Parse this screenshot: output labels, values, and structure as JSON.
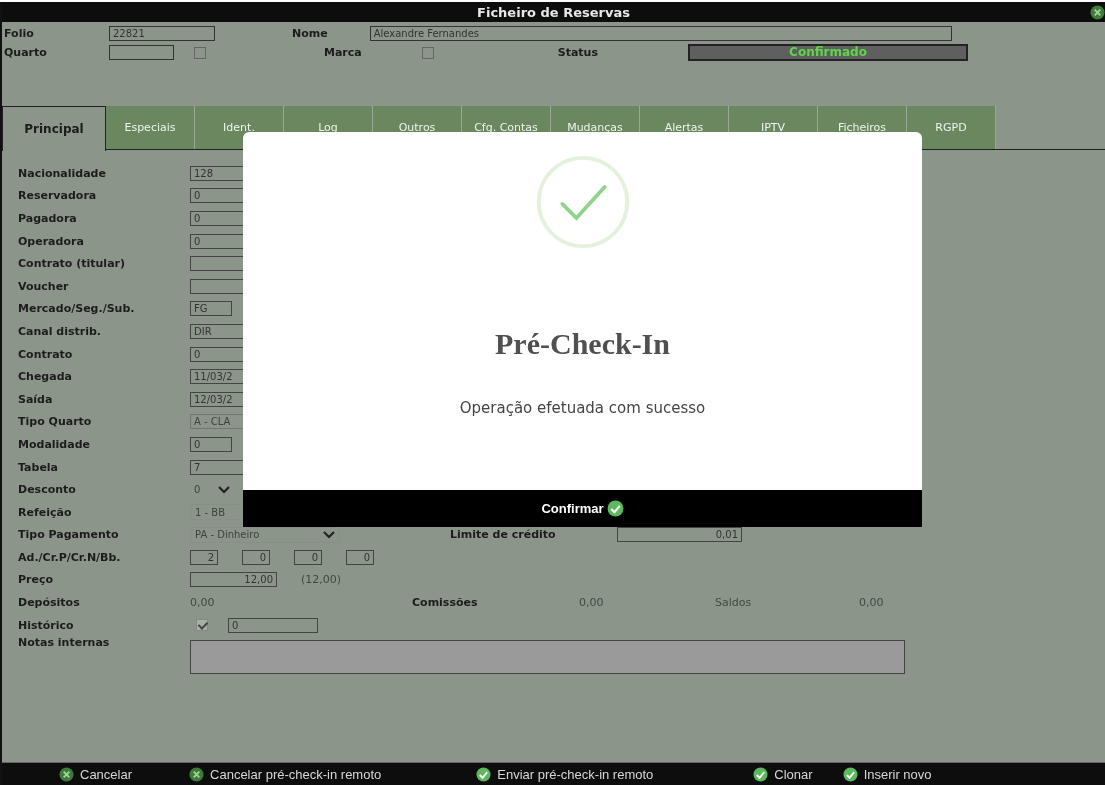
{
  "window": {
    "title": "Ficheiro de Reservas"
  },
  "header": {
    "folio_label": "Folio",
    "folio": "22821",
    "nome_label": "Nome",
    "nome": "Alexandre Fernandes",
    "quarto_label": "Quarto",
    "quarto_checked": false,
    "marca_label": "Marca",
    "marca_checked": false,
    "status_label": "Status",
    "status": "Confirmado"
  },
  "tabs": [
    {
      "label": "Principal",
      "selected": true
    },
    {
      "label": "Especiais",
      "selected": false
    },
    {
      "label": "Ident.",
      "selected": false
    },
    {
      "label": "Log",
      "selected": false
    },
    {
      "label": "Outros",
      "selected": false
    },
    {
      "label": "Cfg. Contas",
      "selected": false
    },
    {
      "label": "Mudanças",
      "selected": false
    },
    {
      "label": "Alertas",
      "selected": false
    },
    {
      "label": "IPTV",
      "selected": false
    },
    {
      "label": "Ficheiros",
      "selected": false
    },
    {
      "label": "RGPD",
      "selected": false
    }
  ],
  "form": {
    "rows": [
      {
        "label": "Nacionalidade",
        "controls": [
          {
            "kind": "input",
            "value": "128"
          }
        ]
      },
      {
        "label": "Reservadora",
        "controls": [
          {
            "kind": "input",
            "value": "0"
          }
        ]
      },
      {
        "label": "Pagadora",
        "controls": [
          {
            "kind": "input",
            "value": "0"
          }
        ]
      },
      {
        "label": "Operadora",
        "controls": [
          {
            "kind": "input",
            "value": "0"
          }
        ]
      },
      {
        "label": "Contrato (titular)",
        "controls": [
          {
            "kind": "input"
          }
        ]
      },
      {
        "label": "Voucher",
        "controls": [
          {
            "kind": "input"
          }
        ]
      },
      {
        "label": "Mercado/Seg./Sub.",
        "controls": [
          {
            "kind": "short",
            "value": "FG"
          }
        ]
      },
      {
        "label": "Canal distrib.",
        "controls": [
          {
            "kind": "input",
            "value": "DIR"
          }
        ]
      },
      {
        "label": "Contrato",
        "controls": [
          {
            "kind": "input",
            "value": "0"
          }
        ]
      },
      {
        "label": "Chegada",
        "controls": [
          {
            "kind": "input",
            "value": "11/03/2"
          }
        ]
      },
      {
        "label": "Saída",
        "controls": [
          {
            "kind": "input",
            "value": "12/03/2"
          }
        ]
      },
      {
        "label": "Tipo Quarto",
        "controls": [
          {
            "kind": "disabled",
            "value": "A - CLA"
          }
        ]
      },
      {
        "label": "Modalidade",
        "controls": [
          {
            "kind": "short",
            "value": "0"
          }
        ]
      },
      {
        "label": "Tabela",
        "controls": [
          {
            "kind": "input",
            "value": "7"
          }
        ]
      },
      {
        "label": "Desconto",
        "controls": [
          {
            "kind": "minisel",
            "value": "0"
          },
          {
            "kind": "gap"
          },
          {
            "kind": "empty"
          }
        ]
      },
      {
        "label": "Refeição",
        "controls": [
          {
            "kind": "select",
            "value": "1 - BB"
          }
        ]
      },
      {
        "label": "Tipo Pagamento",
        "controls": [
          {
            "kind": "select",
            "value": "PA - Dinheiro"
          },
          {
            "kind": "label",
            "value": "Limite de crédito"
          },
          {
            "kind": "amount",
            "value": "0,01"
          }
        ]
      },
      {
        "label": "Ad./Cr.P/Cr.N/Bb.",
        "controls": [
          {
            "kind": "num",
            "value": "2"
          },
          {
            "kind": "num",
            "value": "0"
          },
          {
            "kind": "num",
            "value": "0"
          },
          {
            "kind": "num",
            "value": "0"
          }
        ]
      },
      {
        "label": "Preço",
        "controls": [
          {
            "kind": "price",
            "value": "12,00"
          },
          {
            "kind": "muted",
            "value": "(12,00)"
          }
        ]
      },
      {
        "label": "Depósitos",
        "controls": [
          {
            "kind": "muted",
            "value": "0,00"
          },
          {
            "kind": "label",
            "value": "Comissões"
          },
          {
            "kind": "muted",
            "value": "0,00"
          },
          {
            "kind": "mutedlabel",
            "value": "Saldos"
          },
          {
            "kind": "muted",
            "value": "0,00"
          }
        ]
      },
      {
        "label": "Histórico",
        "controls": [
          {
            "kind": "checkbox",
            "checked": true
          },
          {
            "kind": "hist",
            "value": "0"
          }
        ]
      },
      {
        "label": "Notas internas",
        "controls": [
          {
            "kind": "textarea"
          }
        ]
      }
    ]
  },
  "dialog": {
    "title": "Pré-Check-In",
    "message": "Operação efetuada com sucesso",
    "button": "Confirmar"
  },
  "footer": [
    {
      "label": "Cancelar",
      "kind": "cancel"
    },
    {
      "label": "Cancelar pré-check-in remoto",
      "kind": "cancel"
    },
    {
      "label": "Enviar pré-check-in remoto",
      "kind": "ok"
    },
    {
      "label": "Clonar",
      "kind": "ok"
    },
    {
      "label": "Inserir novo",
      "kind": "ok"
    }
  ]
}
